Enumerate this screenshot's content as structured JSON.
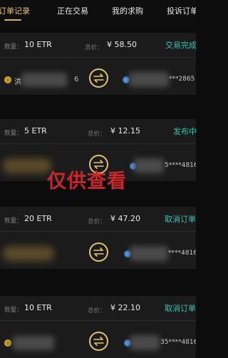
{
  "tabs": [
    {
      "label": "订单记录",
      "active": true
    },
    {
      "label": "正在交易",
      "active": false
    },
    {
      "label": "我的求购",
      "active": false
    },
    {
      "label": "投诉订单",
      "active": false
    }
  ],
  "colors": {
    "background": "#0c0c0c",
    "card": "#1b1b1b",
    "accent_gold": "#d9b45e",
    "status_teal": "#36c4b4",
    "watermark_red": "#c9272d",
    "coin_gold": "#d9a730",
    "coin_blue": "#2f7fd6"
  },
  "labels": {
    "quantity": "数量：",
    "total": "总价："
  },
  "icons": {
    "seller": "gold-coin-icon",
    "swap": "swap-arrows-icon",
    "buyer": "blue-coin-icon"
  },
  "orders": [
    {
      "quantity": "10 ETR",
      "total": "¥ 58.50",
      "status": "交易完成",
      "seller_name": "洪",
      "seller_tail": "6",
      "buyer_suffix": "***2865"
    },
    {
      "quantity": "5 ETR",
      "total": "¥ 12.15",
      "status": "发布中",
      "buyer_suffix": "5****4816"
    },
    {
      "quantity": "20 ETR",
      "total": "¥ 47.20",
      "status": "取消订单",
      "buyer_suffix": "****4816"
    },
    {
      "quantity": "10 ETR",
      "total": "¥ 22.10",
      "status": "取消订单",
      "buyer_suffix": "35****4816"
    }
  ],
  "watermark": "仅供查看"
}
